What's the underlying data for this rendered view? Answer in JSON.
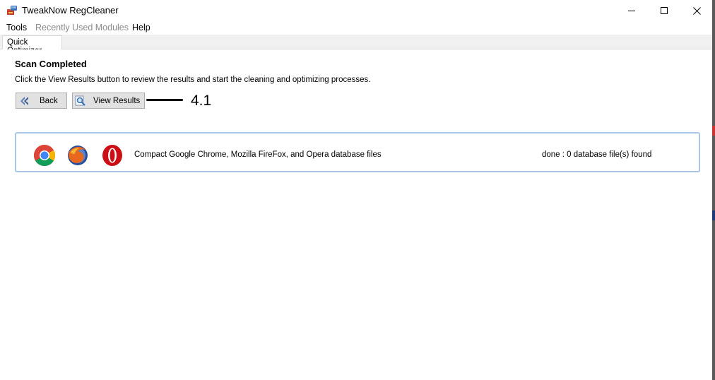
{
  "window": {
    "title": "TweakNow RegCleaner",
    "icon": "regcleaner-app-icon"
  },
  "menu": {
    "items": [
      "Tools",
      "Recently Used Modules",
      "Help"
    ]
  },
  "tabs": [
    {
      "label": "Quick Optimizer",
      "active": true
    }
  ],
  "main": {
    "heading": "Scan Completed",
    "description": "Click the View Results button to review the results and start the cleaning and optimizing processes.",
    "buttons": {
      "back": {
        "label": "Back",
        "icon": "back-arrow-icon"
      },
      "view_results": {
        "label": "View Results",
        "icon": "magnifier-icon"
      }
    },
    "annotation": "4.1"
  },
  "result": {
    "icons": [
      "chrome-icon",
      "firefox-icon",
      "opera-icon"
    ],
    "description": "Compact Google Chrome, Mozilla FireFox, and Opera database files",
    "status": "done : 0 database file(s) found"
  },
  "colors": {
    "panel_border": "#a9c6e8",
    "button_face": "#e1e1e1",
    "disabled_menu": "#8a8a8a"
  }
}
